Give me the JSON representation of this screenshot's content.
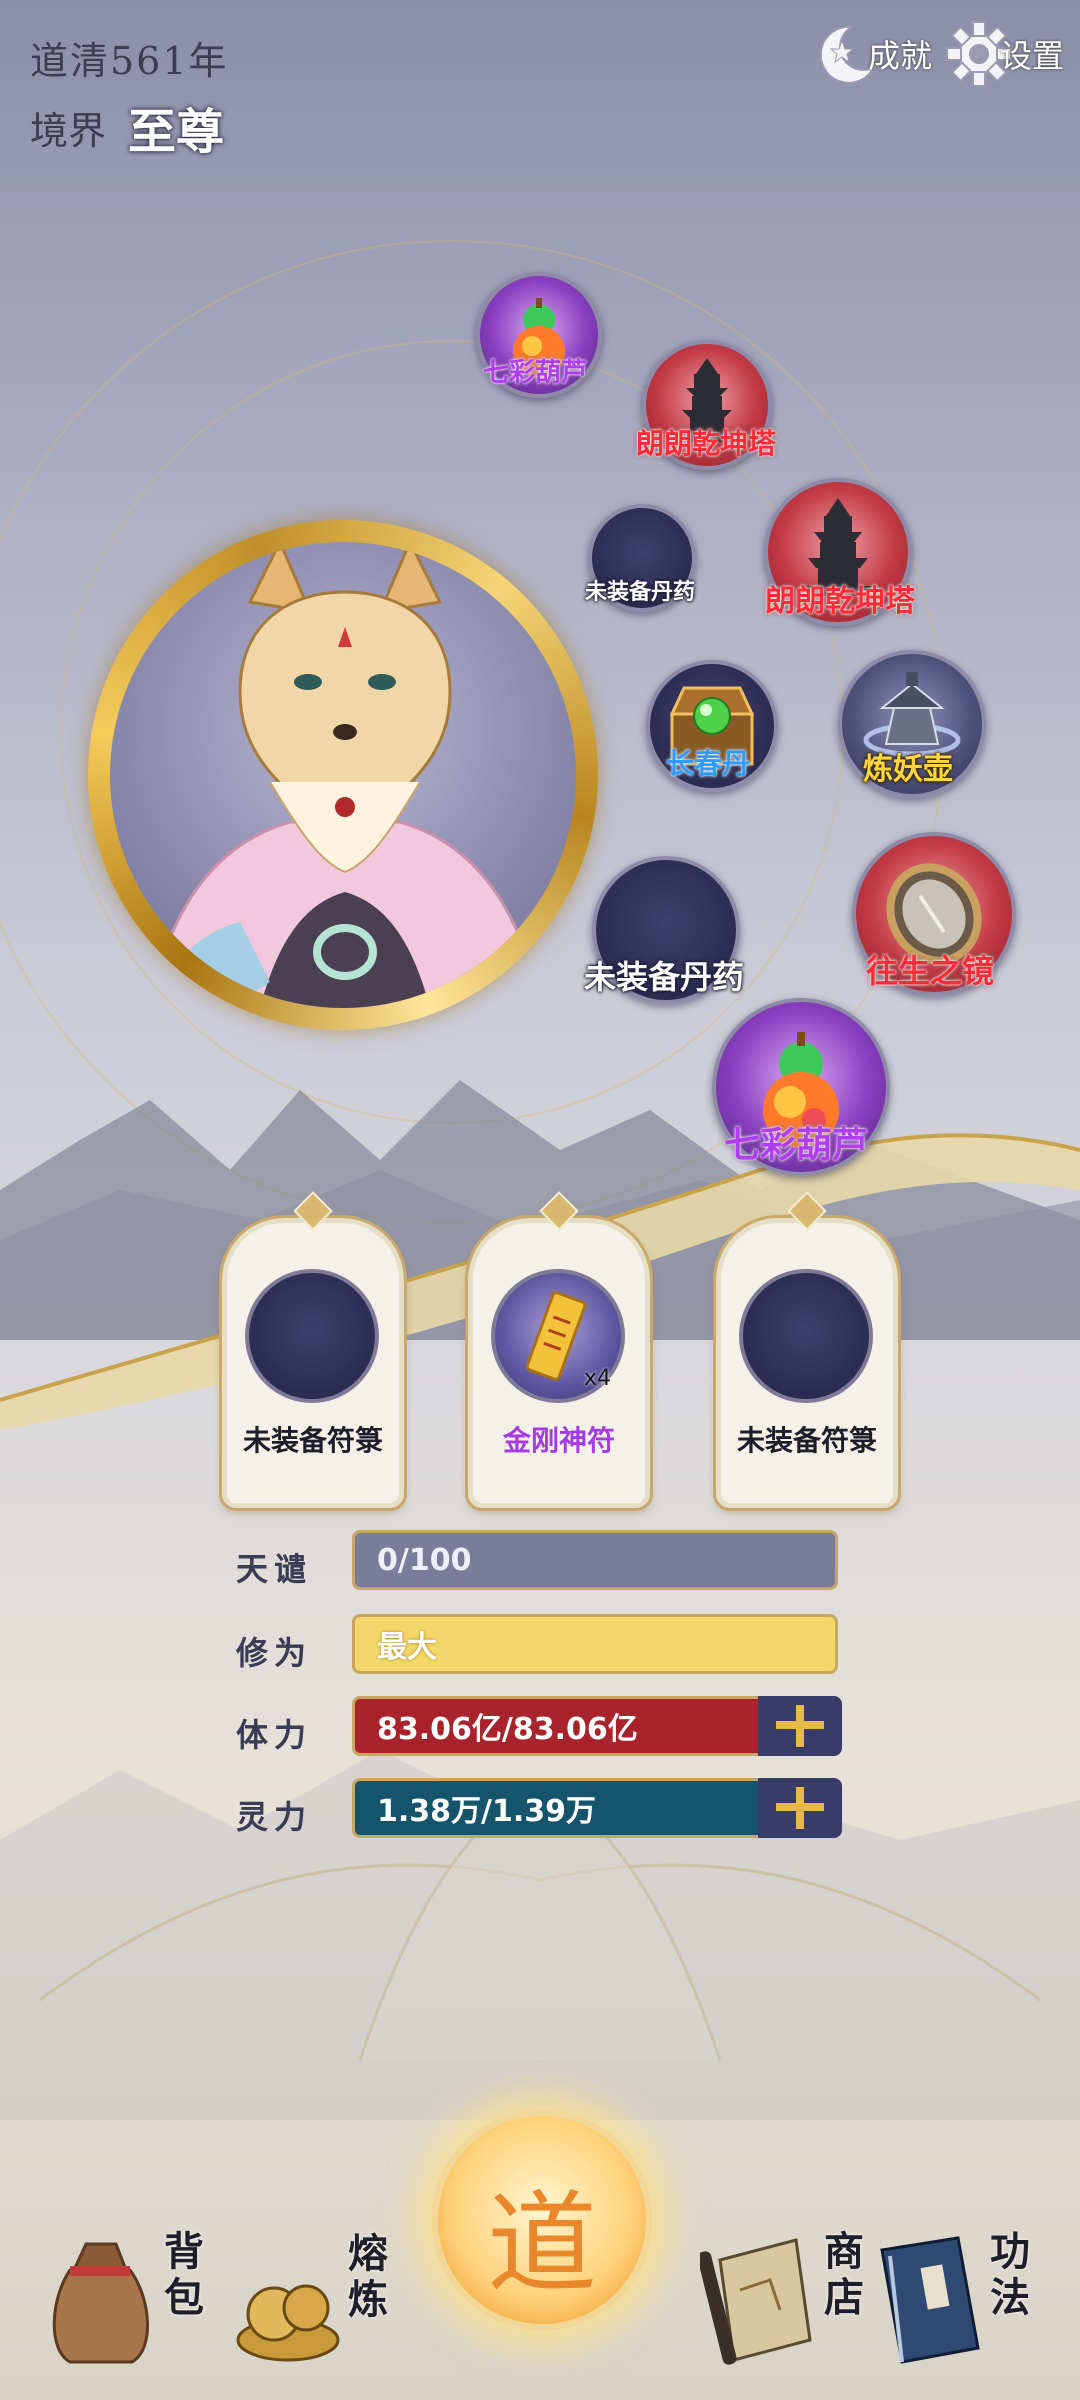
{
  "header": {
    "year": "道清561年",
    "realm_label": "境界",
    "realm_value": "至尊",
    "achievements_label": "成就",
    "settings_label": "设置"
  },
  "equipment": {
    "slots": [
      {
        "label": "七彩葫芦",
        "icon": "gourd-icon"
      },
      {
        "label": "朗朗乾坤塔",
        "icon": "pagoda-icon"
      },
      {
        "label": "未装备丹药",
        "icon": "empty-slot"
      },
      {
        "label": "朗朗乾坤塔",
        "icon": "pagoda-icon"
      },
      {
        "label": "长春丹",
        "icon": "treasure-chest-icon"
      },
      {
        "label": "炼妖壶",
        "icon": "demon-pot-icon"
      },
      {
        "label": "未装备丹药",
        "icon": "empty-slot"
      },
      {
        "label": "往生之镜",
        "icon": "mirror-icon"
      },
      {
        "label": "七彩葫芦",
        "icon": "gourd-icon"
      }
    ]
  },
  "talismans": [
    {
      "label": "未装备符箓",
      "count": ""
    },
    {
      "label": "金刚神符",
      "count": "x4"
    },
    {
      "label": "未装备符箓",
      "count": ""
    }
  ],
  "stats": {
    "tianqian": {
      "label": "天谴",
      "value": "0/100",
      "fraction": 0
    },
    "xiuwei": {
      "label": "修为",
      "value": "最大",
      "fraction": 1
    },
    "tili": {
      "label": "体力",
      "value": "83.06亿/83.06亿",
      "fraction": 1
    },
    "lingli": {
      "label": "灵力",
      "value": "1.38万/1.39万",
      "fraction": 0.99
    }
  },
  "nav": {
    "bag": "背包",
    "smelt": "熔炼",
    "dao": "道",
    "shop": "商店",
    "skills": "功法"
  },
  "colors": {
    "gold": "#d8b060",
    "hp_red": "#a8232b",
    "mana_teal": "#16546c",
    "cultivation_yellow": "#f2d86a",
    "punish_slate": "#7a7c9a"
  }
}
